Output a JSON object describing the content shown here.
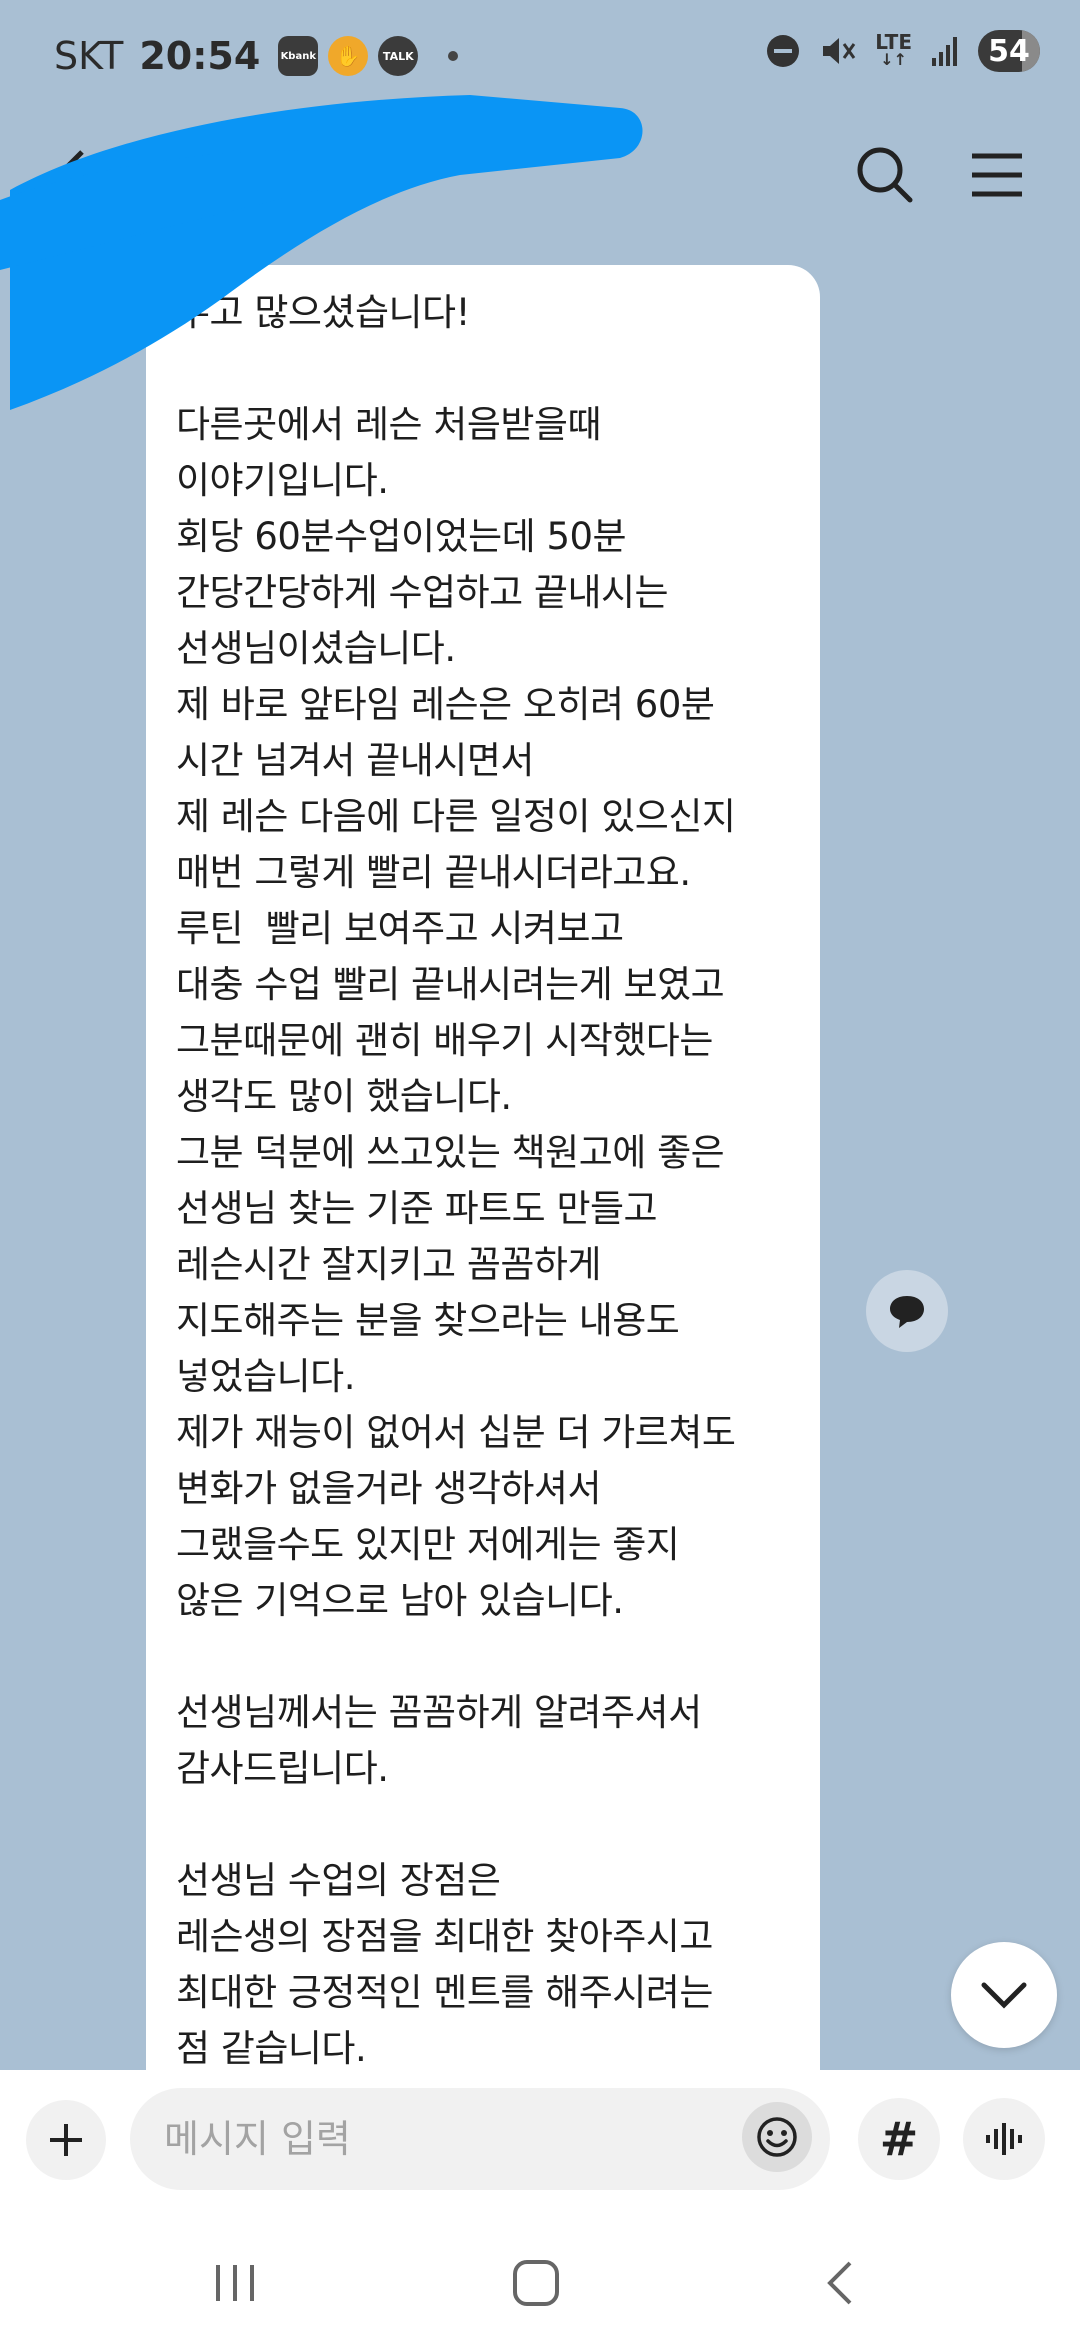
{
  "status_bar": {
    "carrier": "SKT",
    "time": "20:54",
    "notification_icons": [
      "kbank-icon",
      "coin-icon",
      "talk-icon"
    ],
    "kbank_label": "Kbank",
    "talk_label": "TALK",
    "network": "LTE",
    "battery": "54"
  },
  "header": {
    "title": "",
    "back_icon": "back-arrow-icon",
    "search_icon": "search-icon",
    "menu_icon": "hamburger-menu-icon",
    "redaction_color": "#0a95f5"
  },
  "message": {
    "text": "수고 많으셨습니다!\n\n다른곳에서 레슨 처음받을때\n이야기입니다.\n회당 60분수업이었는데 50분\n간당간당하게 수업하고 끝내시는\n선생님이셨습니다.\n제 바로 앞타임 레슨은 오히려 60분\n시간 넘겨서 끝내시면서\n제 레슨 다음에 다른 일정이 있으신지\n매번 그렇게 빨리 끝내시더라고요.\n루틴  빨리 보여주고 시켜보고\n대충 수업 빨리 끝내시려는게 보였고\n그분때문에 괜히 배우기 시작했다는\n생각도 많이 했습니다.\n그분 덕분에 쓰고있는 책원고에 좋은\n선생님 찾는 기준 파트도 만들고\n레슨시간 잘지키고 꼼꼼하게\n지도해주는 분을 찾으라는 내용도\n넣었습니다.\n제가 재능이 없어서 십분 더 가르쳐도\n변화가 없을거라 생각하셔서\n그랬을수도 있지만 저에게는 좋지\n않은 기억으로 남아 있습니다.\n\n선생님께서는 꼼꼼하게 알려주셔서\n감사드립니다.\n\n선생님 수업의 장점은\n레슨생의 장점을 최대한 찾아주시고\n최대한 긍정적인 멘트를 해주시려는\n점 같습니다."
  },
  "input_bar": {
    "placeholder": "메시지 입력",
    "plus_icon": "plus-icon",
    "emoji_icon": "emoji-icon",
    "hash_label": "#",
    "voice_icon": "voice-icon"
  },
  "nav_bar": {
    "recents_icon": "recents-icon",
    "home_icon": "home-icon",
    "back_icon": "back-icon"
  },
  "colors": {
    "chat_background": "#a9bfd3",
    "bubble": "#ffffff"
  }
}
